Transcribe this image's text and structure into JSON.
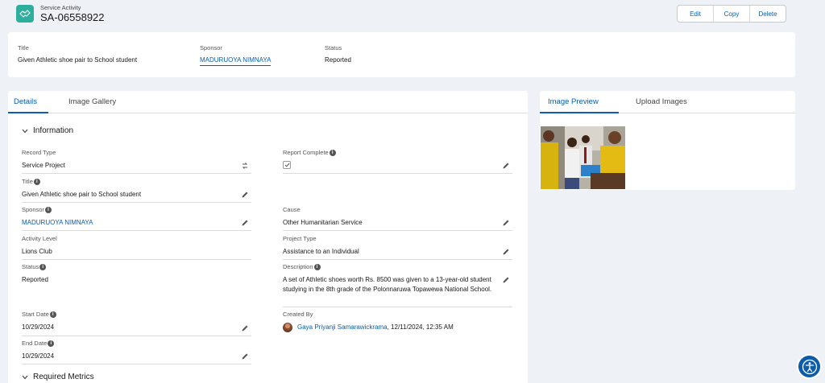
{
  "header": {
    "object_type": "Service Activity",
    "record_id": "SA-06558922",
    "icon": "handshake-icon",
    "actions": [
      "Edit",
      "Copy",
      "Delete"
    ]
  },
  "highlights": {
    "title_label": "Title",
    "title_value": "Given Athletic shoe pair to School student",
    "sponsor_label": "Sponsor",
    "sponsor_value": "MADURUOYA NIMNAYA",
    "status_label": "Status",
    "status_value": "Reported"
  },
  "tabs_left": [
    "Details",
    "Image Gallery"
  ],
  "tabs_right": [
    "Image Preview",
    "Upload Images"
  ],
  "section": {
    "information": "Information",
    "required_metrics": "Required Metrics"
  },
  "fields": {
    "record_type": {
      "label": "Record Type",
      "value": "Service Project"
    },
    "report_complete": {
      "label": "Report Complete",
      "checked": true
    },
    "title": {
      "label": "Title",
      "value": "Given Athletic shoe pair to School student"
    },
    "sponsor": {
      "label": "Sponsor",
      "value": "MADURUOYA NIMNAYA"
    },
    "cause": {
      "label": "Cause",
      "value": "Other Humanitarian Service"
    },
    "activity_level": {
      "label": "Activity Level",
      "value": "Lions Club"
    },
    "project_type": {
      "label": "Project Type",
      "value": "Assistance to an Individual"
    },
    "status": {
      "label": "Status",
      "value": "Reported"
    },
    "description": {
      "label": "Description",
      "value": "A set of Athletic shoes worth Rs. 8500 was given to a 13-year-old student studying in the 8th grade of the Polonnaruwa Topawewa National School."
    },
    "start_date": {
      "label": "Start Date",
      "value": "10/29/2024"
    },
    "created_by": {
      "label": "Created By",
      "user": "Gaya Priyanji Samarawickrama",
      "timestamp": ", 12/11/2024, 12:35 AM"
    },
    "end_date": {
      "label": "End Date",
      "value": "10/29/2024"
    }
  },
  "colors": {
    "accent": "#0b5cab",
    "icon_bg": "#2eaf9e",
    "page_bg": "#eef1f6"
  }
}
